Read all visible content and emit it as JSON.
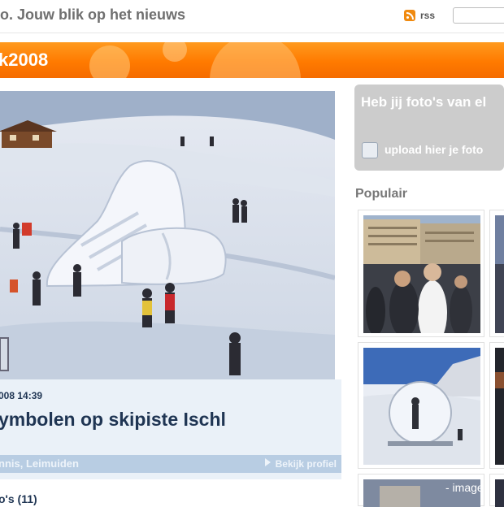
{
  "header": {
    "site_title": "o. Jouw blik op het nieuws",
    "rss_label": "rss",
    "search_placeholder": ""
  },
  "banner": {
    "text": "k2008"
  },
  "photo": {
    "date": "008 14:39",
    "title": "ymbolen op skipiste Ischl",
    "author": "nnis, Leimuiden",
    "profile_link": "Bekijk profiel"
  },
  "comments": {
    "label": "o's (11)"
  },
  "sidebar": {
    "upload_question": "Heb jij foto's van el",
    "upload_link": "upload hier je foto",
    "popular_heading": "Populair"
  },
  "watermark": "- image",
  "colors": {
    "banner_orange": "#ff7a00",
    "title_navy": "#1f3553",
    "panel_blue": "#eaf1f8",
    "author_bar": "#b8cde3",
    "upload_grey": "#cccccc"
  }
}
